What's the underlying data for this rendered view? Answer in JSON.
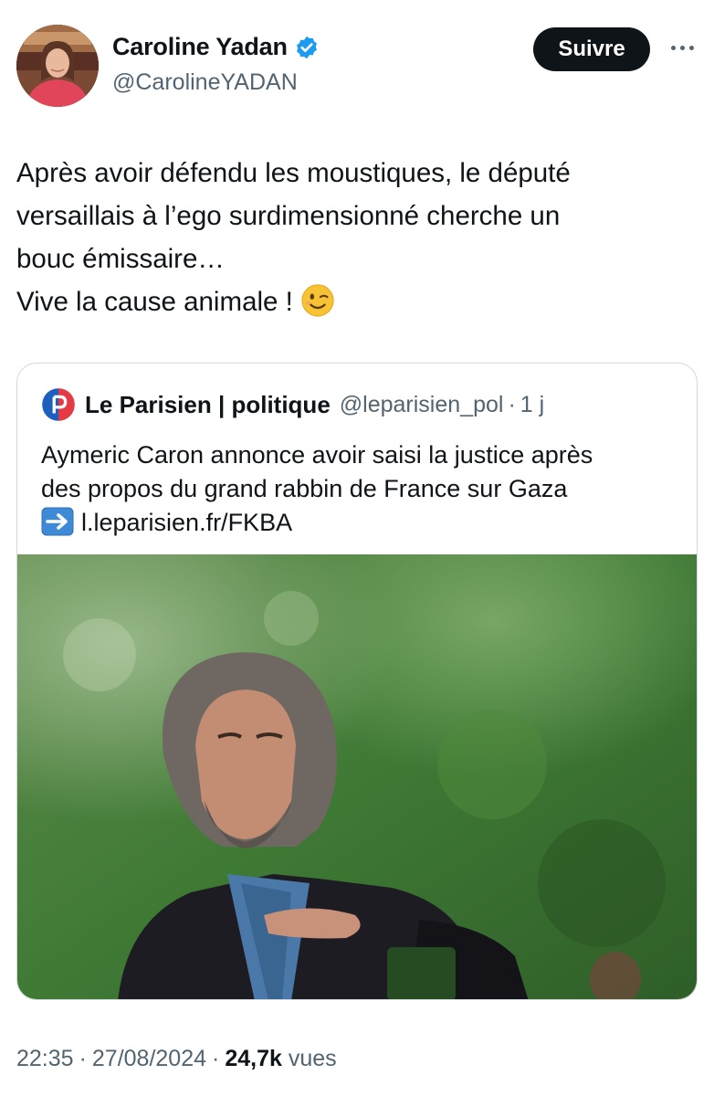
{
  "author": {
    "display_name": "Caroline Yadan",
    "handle": "@CarolineYADAN",
    "verified": true,
    "avatar": "profile-photo"
  },
  "follow_label": "Suivre",
  "more_icon": "ellipsis-icon",
  "tweet": {
    "lines": [
      "Après avoir défendu les moustiques, le député",
      "versaillais à l’ego surdimensionné  cherche un",
      "bouc émissaire…",
      "Vive la cause animale !"
    ],
    "emoji": "winking-face-emoji"
  },
  "quote": {
    "source_name": "Le Parisien | politique",
    "source_handle": "@leparisien_pol",
    "separator": "·",
    "age": "1 j",
    "lines": [
      "Aymeric Caron annonce avoir saisi la justice après",
      "des propos du grand rabbin de France sur Gaza"
    ],
    "link_icon": "right-arrow-emoji",
    "link": "l.leparisien.fr/FKBA",
    "image": "photo-man-in-park"
  },
  "meta": {
    "time": "22:35",
    "separator": "·",
    "date": "27/08/2024",
    "views_count": "24,7k",
    "views_label": "vues"
  },
  "colors": {
    "text": "#0f1419",
    "secondary": "#536471",
    "verified": "#1d9bf0",
    "border": "#cfd9de",
    "button": "#0f1419"
  }
}
